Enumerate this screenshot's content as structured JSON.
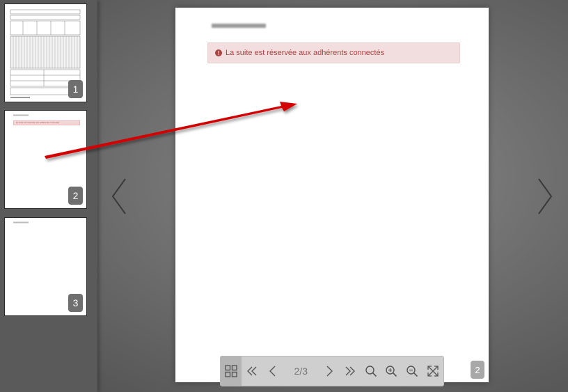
{
  "viewer": {
    "current_page": "2",
    "page_count": "3",
    "page_indicator": "2/3"
  },
  "thumbnails": [
    {
      "number": "1"
    },
    {
      "number": "2",
      "alert_text": "La suite est réservée aux adhérents connectés"
    },
    {
      "number": "3"
    }
  ],
  "page": {
    "alert_text": "La suite est réservée aux adhérents connectés",
    "page_number_badge": "2"
  },
  "toolbar": {
    "icons": [
      "grid-icon",
      "first-page-icon",
      "prev-page-icon",
      "next-page-icon",
      "last-page-icon",
      "search-icon",
      "zoom-in-icon",
      "zoom-out-icon",
      "fullscreen-icon"
    ]
  },
  "colors": {
    "alert_bg": "#f2dede",
    "alert_text": "#a94442",
    "annotation_arrow": "#d40000"
  }
}
